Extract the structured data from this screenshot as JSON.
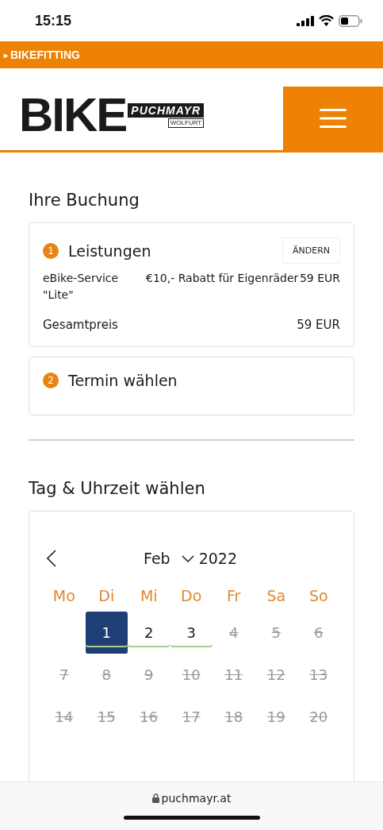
{
  "status_bar": {
    "time": "15:15"
  },
  "promo_bar": {
    "icon": "▸",
    "label": "BIKEFITTING"
  },
  "logo": {
    "main": "BIKE",
    "script": "PUCHMAYR",
    "location": "WOLFURT"
  },
  "booking": {
    "title": "Ihre Buchung",
    "steps": [
      {
        "number": "1",
        "title": "Leistungen",
        "action": "ÄNDERN",
        "items": [
          {
            "name": "eBike-Service \"Lite\"",
            "note": "€10,- Rabatt für Eigenräder",
            "price": "59 EUR"
          }
        ],
        "total_label": "Gesamtpreis",
        "total": "59 EUR"
      },
      {
        "number": "2",
        "title": "Termin wählen"
      }
    ]
  },
  "calendar": {
    "title": "Tag & Uhrzeit wählen",
    "month": "Feb",
    "year": "2022",
    "weekdays": [
      "Mo",
      "Di",
      "Mi",
      "Do",
      "Fr",
      "Sa",
      "So"
    ],
    "days": [
      {
        "kind": "blank"
      },
      {
        "kind": "day",
        "label": "1",
        "selected": true,
        "available": true
      },
      {
        "kind": "day",
        "label": "2",
        "selected": false,
        "available": true
      },
      {
        "kind": "day",
        "label": "3",
        "selected": false,
        "available": true
      },
      {
        "kind": "day",
        "label": "4",
        "selected": false,
        "available": false
      },
      {
        "kind": "day",
        "label": "5",
        "selected": false,
        "available": false
      },
      {
        "kind": "day",
        "label": "6",
        "selected": false,
        "available": false
      },
      {
        "kind": "day",
        "label": "7",
        "selected": false,
        "available": false
      },
      {
        "kind": "day",
        "label": "8",
        "selected": false,
        "available": false
      },
      {
        "kind": "day",
        "label": "9",
        "selected": false,
        "available": false
      },
      {
        "kind": "day",
        "label": "10",
        "selected": false,
        "available": false
      },
      {
        "kind": "day",
        "label": "11",
        "selected": false,
        "available": false
      },
      {
        "kind": "day",
        "label": "12",
        "selected": false,
        "available": false
      },
      {
        "kind": "day",
        "label": "13",
        "selected": false,
        "available": false
      },
      {
        "kind": "day",
        "label": "14",
        "selected": false,
        "available": false
      },
      {
        "kind": "day",
        "label": "15",
        "selected": false,
        "available": false
      },
      {
        "kind": "day",
        "label": "16",
        "selected": false,
        "available": false
      },
      {
        "kind": "day",
        "label": "17",
        "selected": false,
        "available": false
      },
      {
        "kind": "day",
        "label": "18",
        "selected": false,
        "available": false
      },
      {
        "kind": "day",
        "label": "19",
        "selected": false,
        "available": false
      },
      {
        "kind": "day",
        "label": "20",
        "selected": false,
        "available": false
      }
    ]
  },
  "browser_bar": {
    "url": "puchmayr.at"
  }
}
